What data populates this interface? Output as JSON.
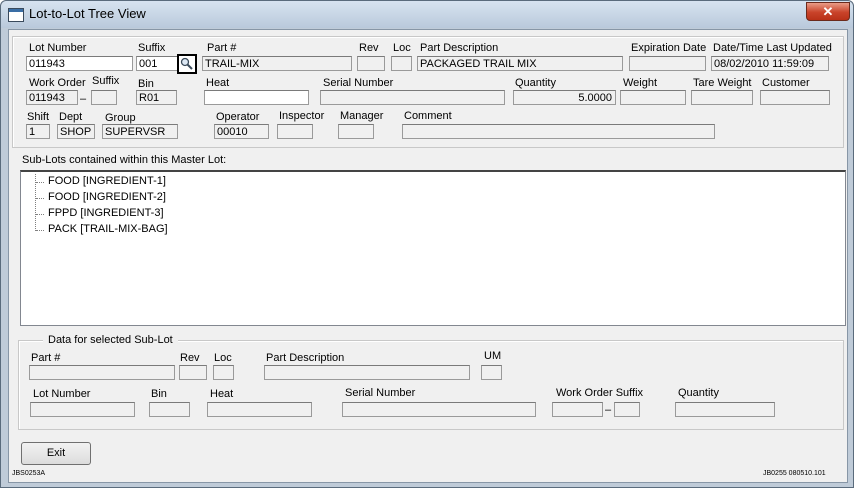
{
  "window": {
    "title": "Lot-to-Lot Tree View",
    "close_glyph": "✕"
  },
  "header": {
    "lot_number": {
      "label": "Lot Number",
      "value": "011943"
    },
    "suffix": {
      "label": "Suffix",
      "value": "001"
    },
    "part": {
      "label": "Part #",
      "value": "TRAIL-MIX"
    },
    "rev": {
      "label": "Rev",
      "value": ""
    },
    "loc": {
      "label": "Loc",
      "value": ""
    },
    "part_description": {
      "label": "Part Description",
      "value": "PACKAGED TRAIL MIX"
    },
    "expiration_date": {
      "label": "Expiration Date",
      "value": ""
    },
    "last_updated": {
      "label": "Date/Time Last Updated",
      "value": "08/02/2010 11:59:09"
    },
    "work_order": {
      "label": "Work Order",
      "value": "011943"
    },
    "wo_suffix": {
      "label": "Suffix",
      "value": ""
    },
    "wo_dash": "–",
    "bin": {
      "label": "Bin",
      "value": "R01"
    },
    "heat": {
      "label": "Heat",
      "value": ""
    },
    "serial_number": {
      "label": "Serial Number",
      "value": ""
    },
    "quantity": {
      "label": "Quantity",
      "value": "5.0000"
    },
    "weight": {
      "label": "Weight",
      "value": ""
    },
    "tare_weight": {
      "label": "Tare Weight",
      "value": ""
    },
    "customer": {
      "label": "Customer",
      "value": ""
    },
    "shift": {
      "label": "Shift",
      "value": "1"
    },
    "dept": {
      "label": "Dept",
      "value": "SHOP"
    },
    "group": {
      "label": "Group",
      "value": "SUPERVSR"
    },
    "operator": {
      "label": "Operator",
      "value": "00010"
    },
    "inspector": {
      "label": "Inspector",
      "value": ""
    },
    "manager": {
      "label": "Manager",
      "value": ""
    },
    "comment": {
      "label": "Comment",
      "value": ""
    }
  },
  "sublots": {
    "heading": "Sub-Lots contained within this Master Lot:",
    "items": [
      {
        "label": "FOOD [INGREDIENT-1]"
      },
      {
        "label": "FOOD [INGREDIENT-2]"
      },
      {
        "label": "FPPD [INGREDIENT-3]"
      },
      {
        "label": "PACK [TRAIL-MIX-BAG]"
      }
    ]
  },
  "selected": {
    "title": "Data for selected Sub-Lot",
    "part": {
      "label": "Part #",
      "value": ""
    },
    "rev": {
      "label": "Rev",
      "value": ""
    },
    "loc": {
      "label": "Loc",
      "value": ""
    },
    "part_description": {
      "label": "Part Description",
      "value": ""
    },
    "um": {
      "label": "UM",
      "value": ""
    },
    "lot_number": {
      "label": "Lot Number",
      "value": ""
    },
    "bin": {
      "label": "Bin",
      "value": ""
    },
    "heat": {
      "label": "Heat",
      "value": ""
    },
    "serial_number": {
      "label": "Serial Number",
      "value": ""
    },
    "work_order_suffix": {
      "label": "Work Order Suffix",
      "value": "",
      "suffix_value": ""
    },
    "wo_dash": "–",
    "quantity": {
      "label": "Quantity",
      "value": ""
    }
  },
  "footer": {
    "exit_label": "Exit",
    "form_id_left": "JBS0253A",
    "form_id_right": "JB0255 080510.101"
  },
  "colors": {
    "title_bg": "#c9d6e5",
    "close": "#c9432a",
    "form_bg": "#f0f0f0"
  },
  "icons": {
    "lookup": "magnifier-icon",
    "app": "window-icon"
  }
}
